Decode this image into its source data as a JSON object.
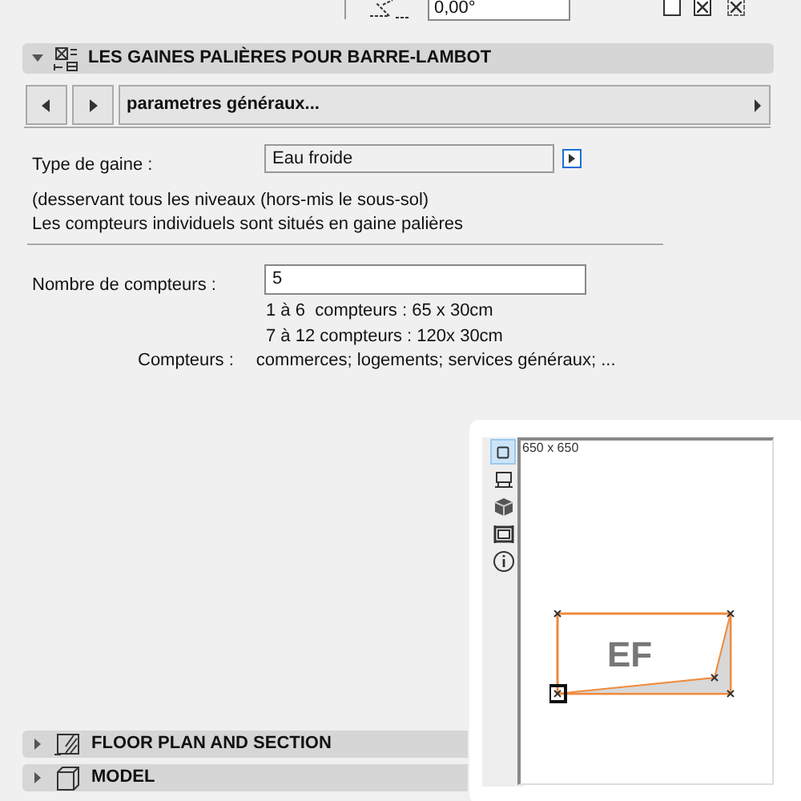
{
  "top_bar": {
    "angle_value": "0,00°",
    "checkboxes": [
      {
        "kind": "solid",
        "checked": false
      },
      {
        "kind": "solid",
        "checked": true
      },
      {
        "kind": "dashed",
        "checked": true
      }
    ]
  },
  "section": {
    "title": "LES GAINES PALIÈRES POUR BARRE-LAMBOT",
    "expanded": true
  },
  "page_nav": {
    "page": "parametres généraux..."
  },
  "type_de_gaine": {
    "label": "Type de gaine :",
    "value": "Eau froide"
  },
  "notes": [
    "(desservant tous les niveaux (hors-mis le sous-sol)",
    "Les compteurs individuels sont situés en gaine palières"
  ],
  "nombre": {
    "label": "Nombre de compteurs :",
    "value": "5",
    "hints": [
      "1 à 6  compteurs : 65 x 30cm",
      "7 à 12 compteurs : 120x 30cm"
    ],
    "compteurs_label": "Compteurs :",
    "compteurs_value": "commerces; logements; services généraux; ..."
  },
  "preview": {
    "tools": [
      {
        "kind": "plan",
        "selected": true
      },
      {
        "kind": "section",
        "selected": false
      },
      {
        "kind": "model",
        "selected": false
      },
      {
        "kind": "frame",
        "selected": false
      },
      {
        "kind": "info",
        "selected": false
      }
    ],
    "size": "650 x 650",
    "shape_label": "EF"
  },
  "collapsed_sections": [
    {
      "title": "FLOOR PLAN AND SECTION",
      "kind": "floorplan",
      "expanded": false
    },
    {
      "title": "MODEL",
      "kind": "model",
      "expanded": false
    }
  ]
}
